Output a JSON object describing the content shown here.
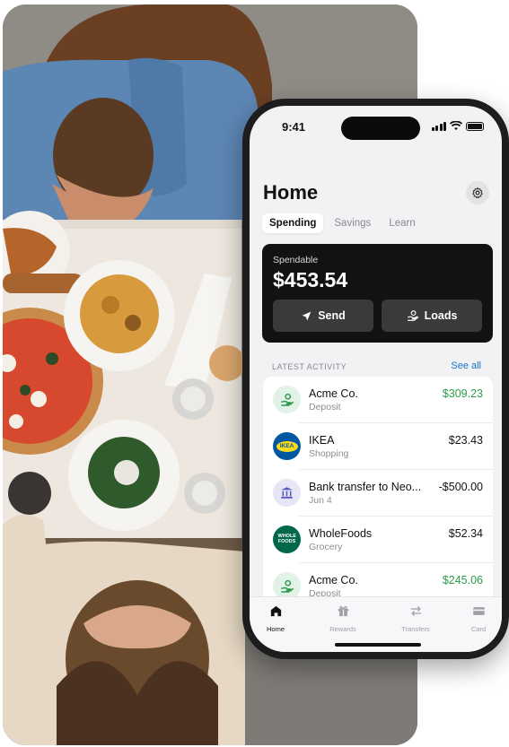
{
  "status": {
    "time": "9:41"
  },
  "header": {
    "title": "Home"
  },
  "tabs": [
    "Spending",
    "Savings",
    "Learn"
  ],
  "card": {
    "label": "Spendable",
    "amount": "$453.54",
    "send_label": "Send",
    "loads_label": "Loads"
  },
  "activity": {
    "heading": "LATEST ACTIVITY",
    "see_all": "See all",
    "items": [
      {
        "name": "Acme Co.",
        "sub": "Deposit",
        "amount": "$309.23",
        "positive": true,
        "icon": "deposit-icon"
      },
      {
        "name": "IKEA",
        "sub": "Shopping",
        "amount": "$23.43",
        "positive": false,
        "icon": "ikea-logo",
        "logo_text": "IKEA"
      },
      {
        "name": "Bank transfer to Neo...",
        "sub": "Jun 4",
        "amount": "-$500.00",
        "positive": false,
        "icon": "bank-icon"
      },
      {
        "name": "WholeFoods",
        "sub": "Grocery",
        "amount": "$52.34",
        "positive": false,
        "icon": "wholefoods-logo",
        "logo_text": "WHOLE FOODS"
      },
      {
        "name": "Acme Co.",
        "sub": "Deposit",
        "amount": "$245.06",
        "positive": true,
        "icon": "deposit-icon"
      }
    ]
  },
  "tabbar": [
    "Home",
    "Rewards",
    "Transfers",
    "Card"
  ],
  "colors": {
    "positive": "#2e9b4c",
    "link": "#1a73c8",
    "card": "#121212"
  }
}
